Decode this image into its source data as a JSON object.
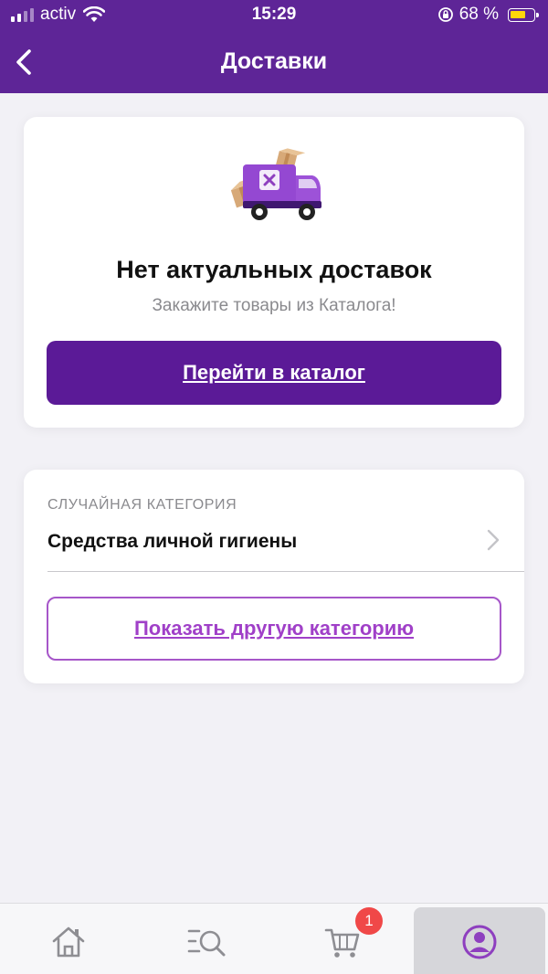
{
  "status_bar": {
    "carrier": "activ",
    "time": "15:29",
    "battery_percent": "68 %",
    "battery_level": 0.68,
    "icons": [
      "signal-icon",
      "wifi-icon",
      "rotation-lock-icon",
      "battery-icon"
    ]
  },
  "header": {
    "title": "Доставки",
    "back_icon": "chevron-left-icon",
    "color": "#5e2597"
  },
  "empty_state": {
    "illustration": "delivery-truck-icon",
    "title": "Нет актуальных доставок",
    "subtitle": "Закажите товары из Каталога!",
    "button_label": "Перейти в каталог",
    "button_color": "#5b1a97"
  },
  "random_category": {
    "caption": "СЛУЧАЙНАЯ КАТЕГОРИЯ",
    "name": "Средства личной гигиены",
    "button_label": "Показать другую категорию",
    "accent": "#a040c8"
  },
  "tabbar": {
    "tabs": [
      {
        "icon": "home-icon",
        "active": false
      },
      {
        "icon": "catalog-search-icon",
        "active": false
      },
      {
        "icon": "cart-icon",
        "active": false,
        "badge": "1"
      },
      {
        "icon": "profile-icon",
        "active": true
      }
    ],
    "cart_badge": "1",
    "badge_color": "#f04848",
    "active_color": "#8e3fbf"
  }
}
